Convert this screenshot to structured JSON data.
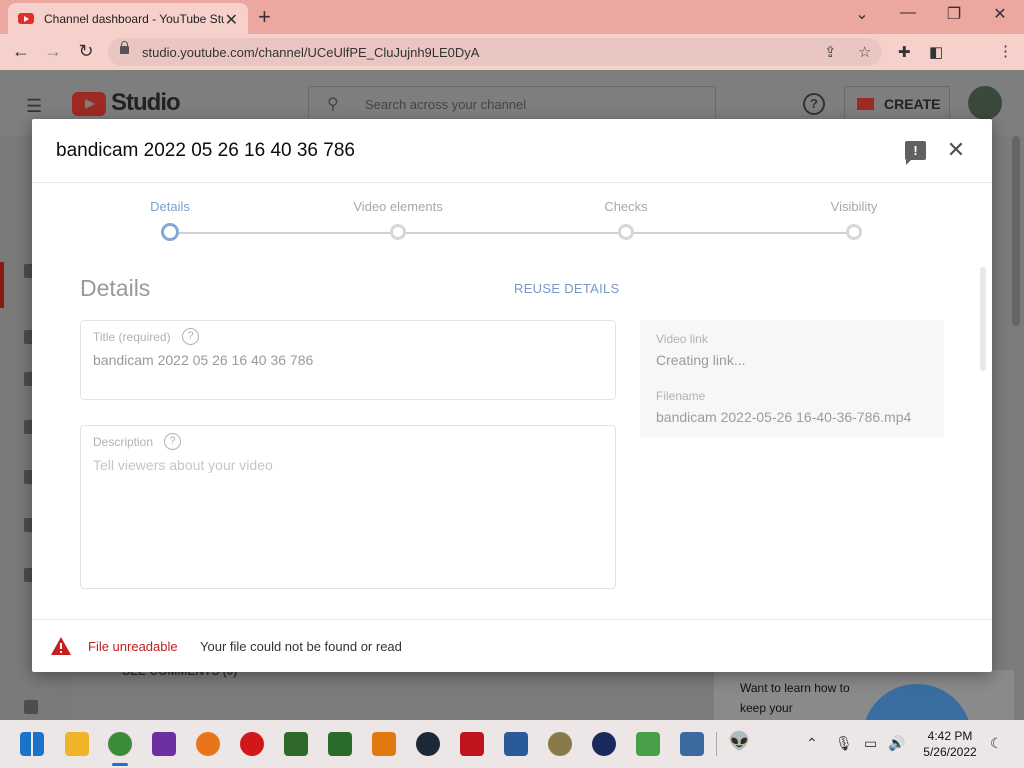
{
  "browser": {
    "tab_title": "Channel dashboard - YouTube Studio",
    "url": "studio.youtube.com/channel/UCeUlfPE_CluJujnh9LE0DyA",
    "new_tab": "+",
    "minimize": "⌄",
    "min_icon": "—",
    "restore_icon": "❐",
    "close_icon": "✕"
  },
  "studio": {
    "logo_text": "Studio",
    "search_placeholder": "Search across your channel",
    "create_label": "CREATE",
    "help": "?",
    "see_comments": "SEE COMMENTS (0)",
    "learn_text": "Want to learn how to keep your"
  },
  "modal": {
    "title": "bandicam 2022 05 26 16 40 36 786",
    "steps": [
      {
        "label": "Details",
        "active": true
      },
      {
        "label": "Video elements",
        "active": false
      },
      {
        "label": "Checks",
        "active": false
      },
      {
        "label": "Visibility",
        "active": false
      }
    ],
    "details_heading": "Details",
    "reuse_details": "REUSE DETAILS",
    "title_field": {
      "label": "Title (required)",
      "value": "bandicam 2022 05 26 16 40 36 786"
    },
    "description_field": {
      "label": "Description",
      "placeholder": "Tell viewers about your video"
    },
    "video_link_label": "Video link",
    "video_link_value": "Creating link...",
    "filename_label": "Filename",
    "filename_value": "bandicam 2022-05-26 16-40-36-786.mp4",
    "error_title": "File unreadable",
    "error_message": "Your file could not be found or read"
  },
  "taskbar": {
    "apps": [
      {
        "name": "start-icon",
        "color": "#1a73c8"
      },
      {
        "name": "file-explorer-icon",
        "color": "#f0b429"
      },
      {
        "name": "chrome-icon",
        "color": "#3c8c3c"
      },
      {
        "name": "onenote-icon",
        "color": "#6b2fa0"
      },
      {
        "name": "firefox-icon",
        "color": "#e8741a"
      },
      {
        "name": "opera-icon",
        "color": "#d01818"
      },
      {
        "name": "tree-app-icon",
        "color": "#2f6a2a"
      },
      {
        "name": "game-app-icon",
        "color": "#2a6a2a"
      },
      {
        "name": "search-tool-icon",
        "color": "#e07a10"
      },
      {
        "name": "steam-icon",
        "color": "#1b2838"
      },
      {
        "name": "gear-app-icon",
        "color": "#c0141c"
      },
      {
        "name": "network-app-icon",
        "color": "#2a5a9a"
      },
      {
        "name": "globe-app-icon",
        "color": "#8a7a4a"
      },
      {
        "name": "infra-app-icon",
        "color": "#1a2a5a"
      },
      {
        "name": "notes-app-icon",
        "color": "#4aa04a"
      },
      {
        "name": "remote-app-icon",
        "color": "#3a6aa0"
      }
    ],
    "time": "4:42 PM",
    "date": "5/26/2022"
  }
}
